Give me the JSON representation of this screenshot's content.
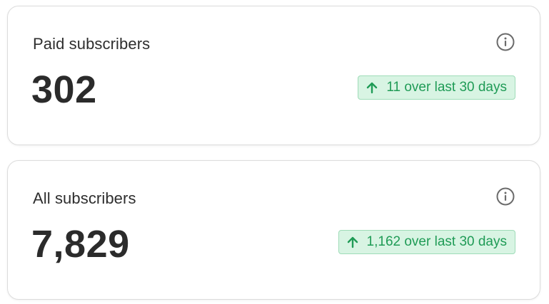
{
  "cards": [
    {
      "title": "Paid subscribers",
      "value": "302",
      "trend": "11 over last 30 days",
      "trend_icon": "arrow-up-icon",
      "info_icon": "info-icon"
    },
    {
      "title": "All subscribers",
      "value": "7,829",
      "trend": "1,162 over last 30 days",
      "trend_icon": "arrow-up-icon",
      "info_icon": "info-icon"
    }
  ],
  "colors": {
    "trend_text": "#1f9b56",
    "trend_bg": "#d8f4e3",
    "trend_border": "#9fdcb8",
    "card_border": "#dcdcdc",
    "value_text": "#2b2b2b"
  }
}
